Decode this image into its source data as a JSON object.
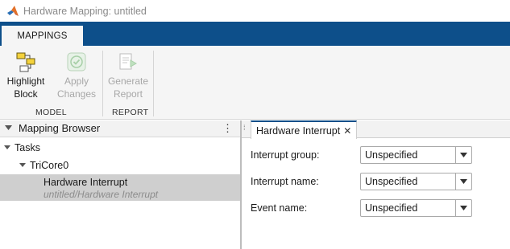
{
  "window": {
    "title": "Hardware Mapping: untitled"
  },
  "tabs": [
    {
      "label": "MAPPINGS",
      "active": true
    }
  ],
  "toolstrip": {
    "groups": [
      {
        "label": "MODEL",
        "buttons": [
          {
            "line1": "Highlight",
            "line2": "Block",
            "enabled": true
          },
          {
            "line1": "Apply",
            "line2": "Changes",
            "enabled": false
          }
        ]
      },
      {
        "label": "REPORT",
        "buttons": [
          {
            "line1": "Generate",
            "line2": "Report",
            "enabled": false
          }
        ]
      }
    ]
  },
  "mapping_browser": {
    "title": "Mapping Browser",
    "tree": [
      {
        "label": "Tasks",
        "expanded": true
      },
      {
        "label": "TriCore0",
        "expanded": true
      },
      {
        "label": "Hardware Interrupt",
        "path": "untitled/Hardware Interrupt",
        "selected": true
      }
    ]
  },
  "editor": {
    "tab_label": "Hardware Interrupt",
    "fields": [
      {
        "label": "Interrupt group:",
        "value": "Unspecified"
      },
      {
        "label": "Interrupt name:",
        "value": "Unspecified"
      },
      {
        "label": "Event name:",
        "value": "Unspecified"
      }
    ]
  },
  "colors": {
    "tabstrip": "#0d4f8a",
    "toolstrip_bg": "#f5f5f5",
    "selected_row": "#cfcfcf",
    "disabled_text": "#a7a7a7"
  }
}
